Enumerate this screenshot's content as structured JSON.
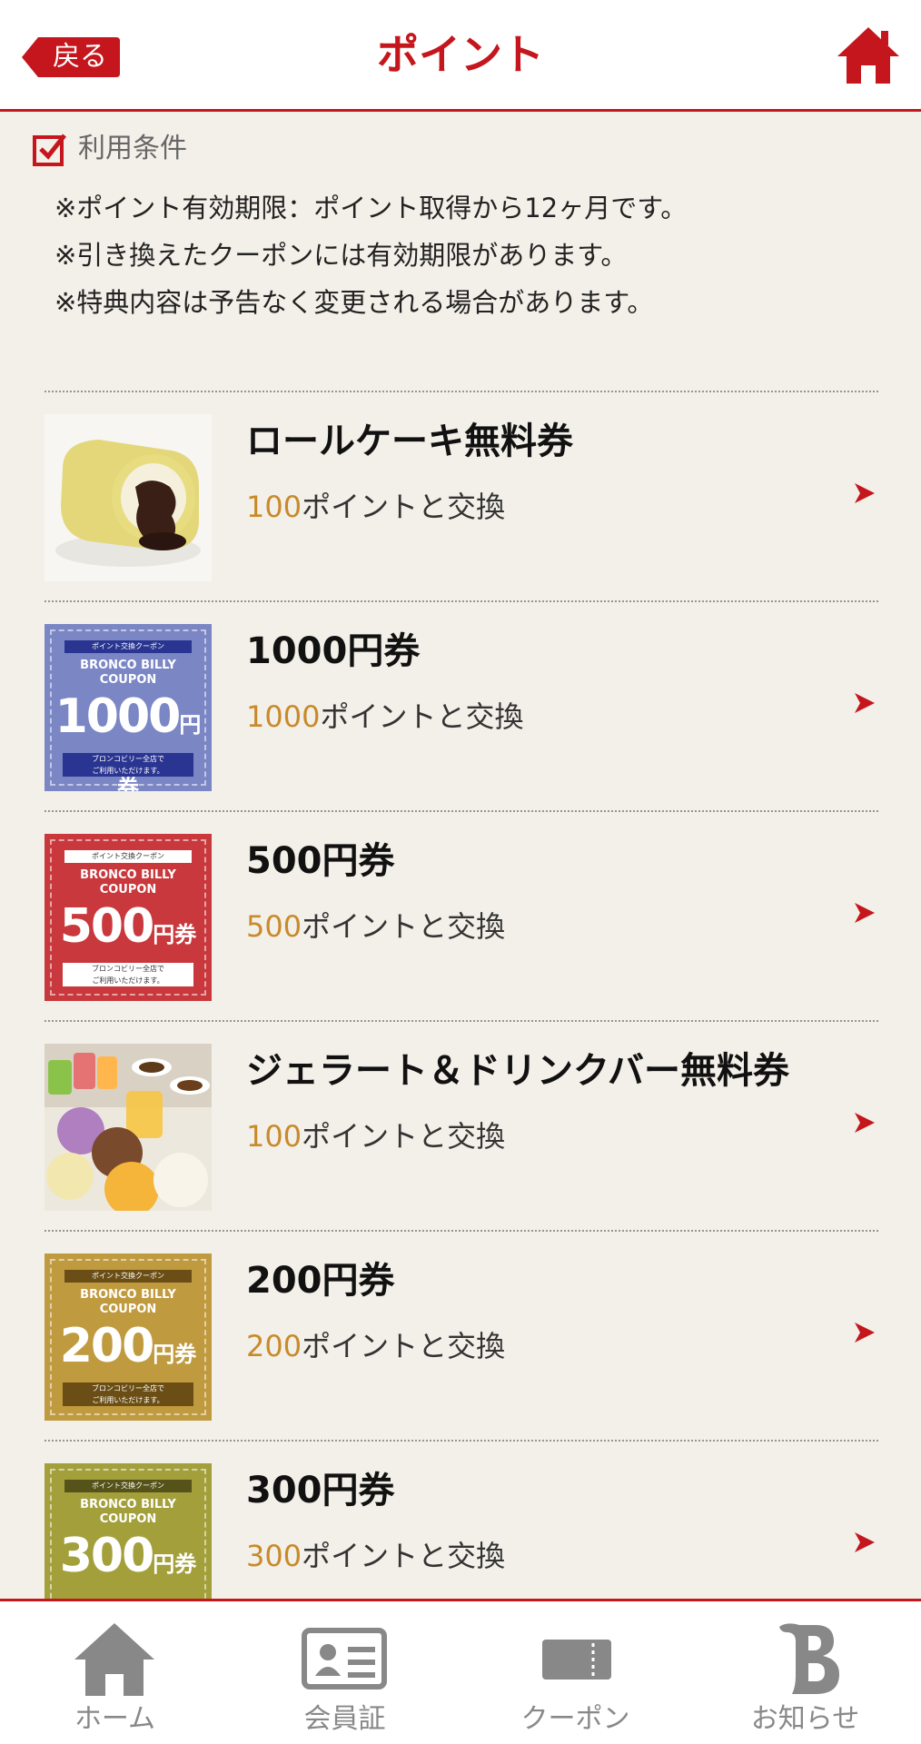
{
  "header": {
    "back_label": "戻る",
    "title": "ポイント",
    "home_icon": "home-icon",
    "accent": "#c4161c"
  },
  "terms": {
    "heading": "利用条件",
    "notes": [
      "※ポイント有効期限：ポイント取得から12ヶ月です。",
      "※引き換えたクーポンには有効期限があります。",
      "※特典内容は予告なく変更される場合があります。"
    ]
  },
  "items": [
    {
      "title": "ロールケーキ無料券",
      "points": "100",
      "suffix": "ポイントと交換"
    },
    {
      "title": "1000円券",
      "points": "1000",
      "suffix": "ポイントと交換",
      "coupon": {
        "top": "ポイント交換クーポン",
        "brand1": "BRONCO BILLY",
        "brand2": "COUPON",
        "amount": "1000",
        "unit": "円券",
        "bottom1": "ブロンコビリー全店で",
        "bottom2": "ご利用いただけます。"
      }
    },
    {
      "title": "500円券",
      "points": "500",
      "suffix": "ポイントと交換",
      "coupon": {
        "top": "ポイント交換クーポン",
        "brand1": "BRONCO BILLY",
        "brand2": "COUPON",
        "amount": "500",
        "unit": "円券",
        "bottom1": "ブロンコビリー全店で",
        "bottom2": "ご利用いただけます。"
      }
    },
    {
      "title": "ジェラート＆ドリンクバー無料券",
      "points": "100",
      "suffix": "ポイントと交換"
    },
    {
      "title": "200円券",
      "points": "200",
      "suffix": "ポイントと交換",
      "coupon": {
        "top": "ポイント交換クーポン",
        "brand1": "BRONCO BILLY",
        "brand2": "COUPON",
        "amount": "200",
        "unit": "円券",
        "bottom1": "ブロンコビリー全店で",
        "bottom2": "ご利用いただけます。"
      }
    },
    {
      "title": "300円券",
      "points": "300",
      "suffix": "ポイントと交換",
      "coupon": {
        "top": "ポイント交換クーポン",
        "brand1": "BRONCO BILLY",
        "brand2": "COUPON",
        "amount": "300",
        "unit": "円券"
      }
    }
  ],
  "tabbar": {
    "tabs": [
      {
        "label": "ホーム",
        "icon": "home-icon"
      },
      {
        "label": "会員証",
        "icon": "member-card-icon"
      },
      {
        "label": "クーポン",
        "icon": "ticket-icon"
      },
      {
        "label": "お知らせ",
        "icon": "b-logo-icon"
      }
    ]
  }
}
